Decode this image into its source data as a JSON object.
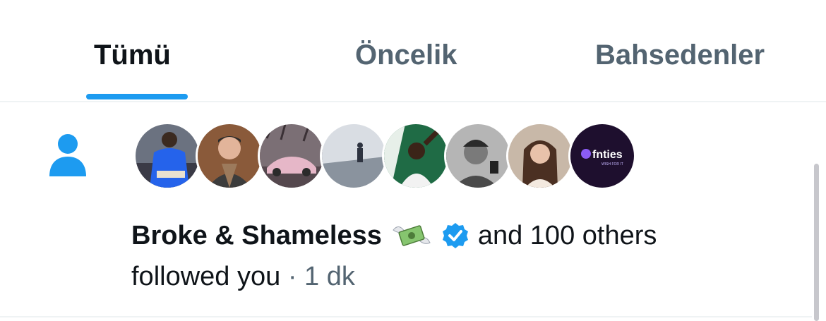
{
  "tabs": [
    {
      "label": "Tümü",
      "active": true
    },
    {
      "label": "Öncelik",
      "active": false
    },
    {
      "label": "Bahsedenler",
      "active": false
    }
  ],
  "colors": {
    "accent": "#1d9bf0",
    "text": "#0f1419",
    "muted": "#536471",
    "divider": "#eff3f4"
  },
  "notification": {
    "icon": "person-icon",
    "avatar_count": 8,
    "last_avatar_logo": "fnties",
    "last_avatar_tagline": "WISH FOR IT",
    "actor_name": "Broke & Shameless",
    "actor_emoji": "money-with-wings-emoji",
    "verified_icon": "verified-badge-icon",
    "others_text": "and 100 others",
    "action_text": "followed you",
    "separator": "·",
    "time": "1 dk"
  }
}
